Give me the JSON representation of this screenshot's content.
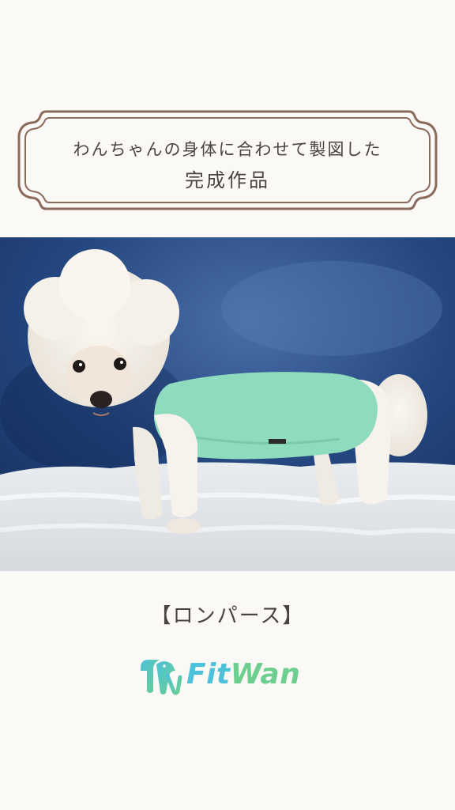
{
  "heading": {
    "line1": "わんちゃんの身体に合わせて製図した",
    "line2": "完成作品"
  },
  "photo": {
    "description_icon": "poodle-in-romper-photo"
  },
  "product": {
    "name": "【ロンパース】"
  },
  "brand": {
    "logo_part1": "Fit",
    "logo_part2": "Wan",
    "color_fit": "#4cc1d9",
    "color_wan": "#6ccf8f"
  },
  "colors": {
    "background": "#fbf9f5",
    "frame": "#8a6a5a",
    "text": "#4a4440"
  }
}
